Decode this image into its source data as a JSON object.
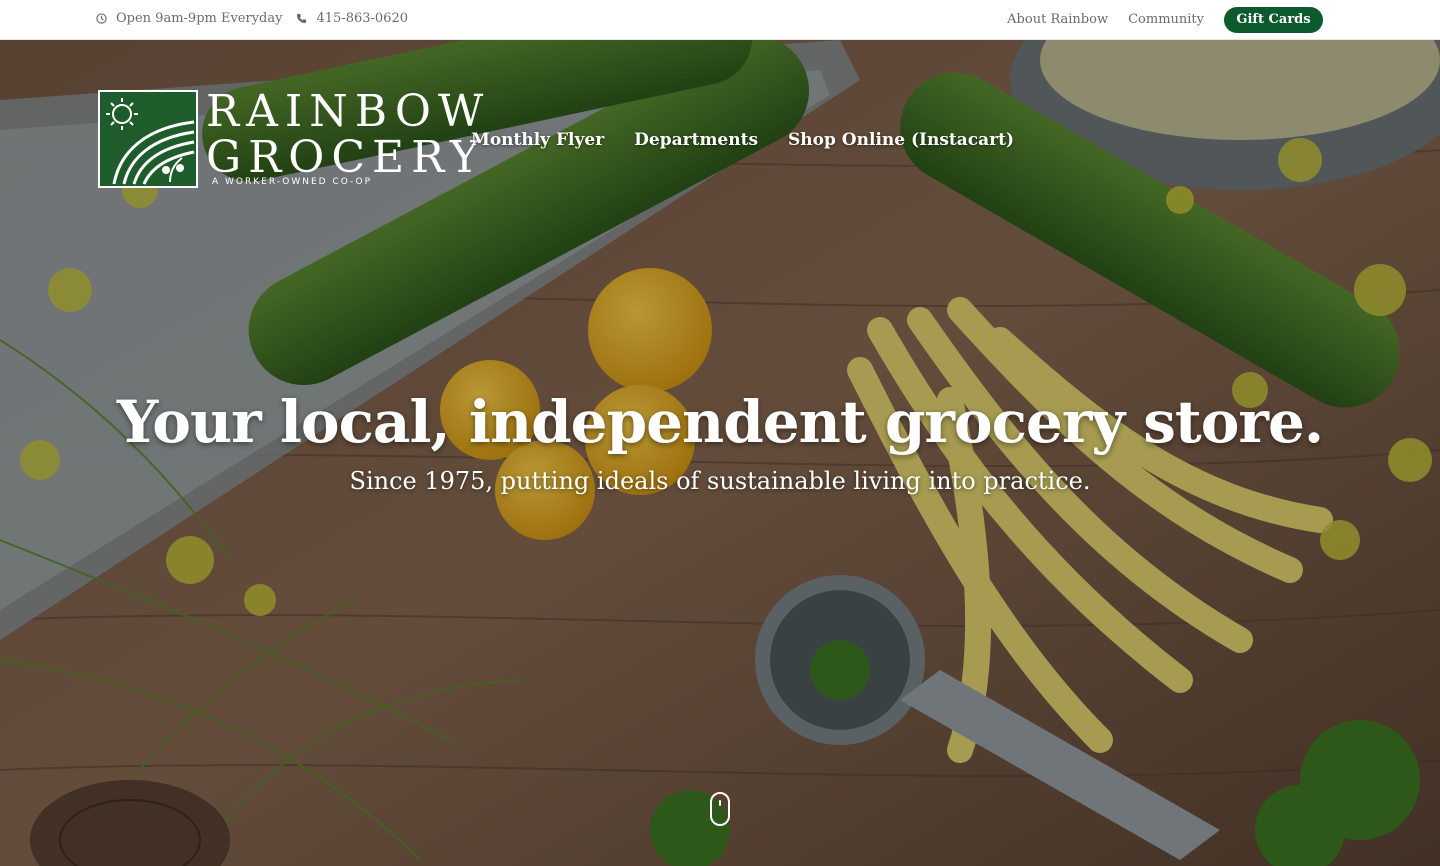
{
  "topbar": {
    "hours": "Open 9am-9pm Everyday",
    "phone": "415-863-0620",
    "links": [
      "About Rainbow",
      "Community"
    ],
    "gift_cards": "Gift Cards"
  },
  "logo": {
    "line1": "RAINBOW",
    "line2": "GROCERY",
    "tagline": "A WORKER-OWNED CO-OP"
  },
  "nav": [
    "Monthly Flyer",
    "Departments",
    "Shop Online (Instacart)"
  ],
  "hero": {
    "headline": "Your local, independent grocery store.",
    "subhead": "Since 1975, putting ideals of sustainable living into practice."
  },
  "colors": {
    "brand_green": "#0e5a2f",
    "logo_green": "#1e5c2c",
    "topbar_text": "#6b6b6b"
  },
  "icons": [
    "clock-icon",
    "phone-icon",
    "scroll-down-icon"
  ]
}
